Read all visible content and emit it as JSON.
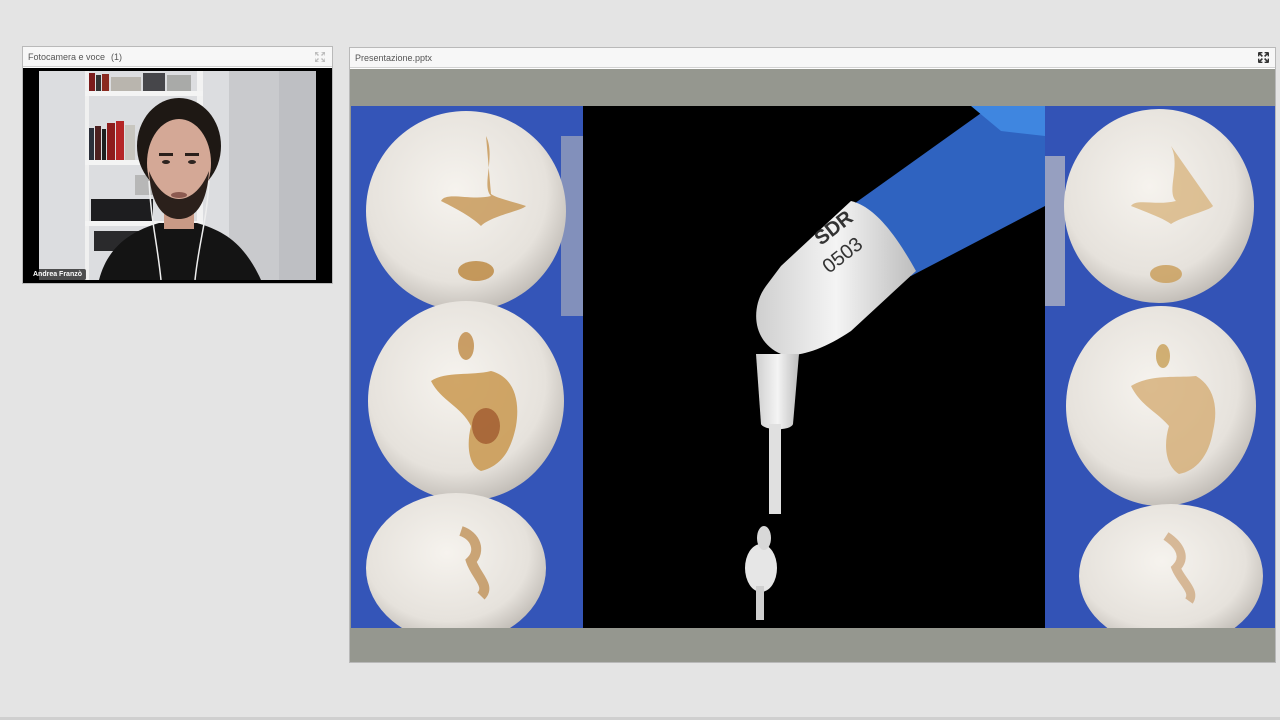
{
  "camera_pod": {
    "title": "Fotocamera e voce",
    "count": "(1)",
    "presenter_name": "Andrea Franzò"
  },
  "presentation_pod": {
    "title": "Presentazione.pptx",
    "slide": {
      "instrument_label_line1": "SDR",
      "instrument_label_line2": "0503"
    }
  },
  "icons": {
    "expand": "fullscreen-expand-icon"
  },
  "colors": {
    "background": "#e4e4e4",
    "pod_header": "#f7f7f7",
    "stage": "#95978f",
    "rubber_dam": "#2f4fb0",
    "applicator_blue": "#2f63c0"
  }
}
